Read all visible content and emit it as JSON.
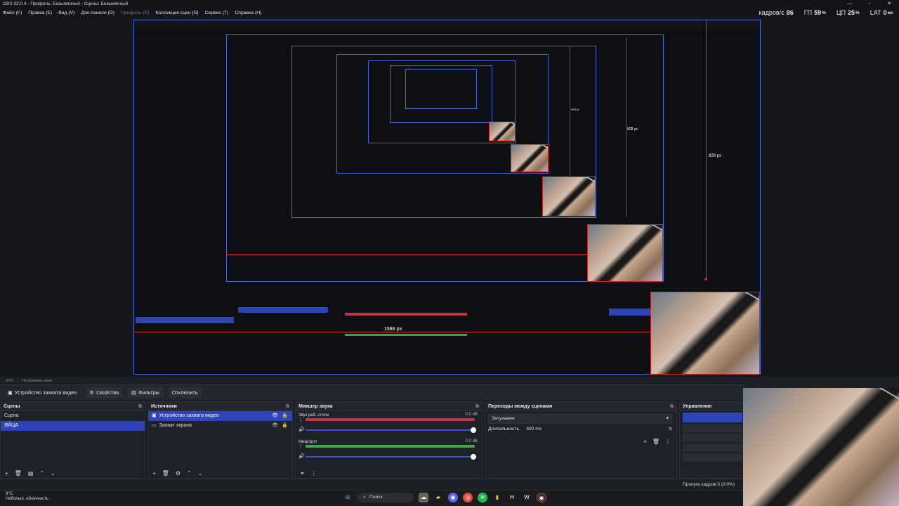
{
  "window": {
    "title": "OBS 32.0.4 - Профиль: Безымянный - Сцены: Безымянный",
    "controls": [
      "—",
      "▫",
      "✕"
    ]
  },
  "menu": [
    {
      "label": "Файл (F)",
      "dim": false
    },
    {
      "label": "Правка (E)",
      "dim": false
    },
    {
      "label": "Вид (V)",
      "dim": false
    },
    {
      "label": "Док-панели (D)",
      "dim": false
    },
    {
      "label": "Профиль (P)",
      "dim": true
    },
    {
      "label": "Коллекция сцен (S)",
      "dim": false
    },
    {
      "label": "Сервис (T)",
      "dim": false
    },
    {
      "label": "Справка (H)",
      "dim": false
    }
  ],
  "stats": {
    "fps_label": "кадров/с",
    "fps": "86",
    "gpu_label": "ГП",
    "gpu": "59",
    "cpu_label": "ЦП",
    "cpu": "25",
    "lat_label": "LAT",
    "lat": "0",
    "lat_unit": "мс",
    "pct": "%"
  },
  "preview": {
    "measure_large": "828 px",
    "measure_mid": "828 px",
    "measure_small": "828 px",
    "width_label": "1586 px"
  },
  "zoom": {
    "value": "92%",
    "mode": "По размеру окна"
  },
  "source_toolbar": {
    "source": "Устройство захвата видео",
    "properties": "Свойства",
    "filters": "Фильтры",
    "deactivate": "Отключить"
  },
  "scenes": {
    "title": "Сцены",
    "items": [
      "Сцена",
      "ЯЙЦА"
    ],
    "selected": 1
  },
  "sources": {
    "title": "Источники",
    "items": [
      "Устройство захвата видео",
      "Захват экрана"
    ],
    "selected": 0
  },
  "mixer": {
    "title": "Микшер звука",
    "tracks": [
      {
        "name": "Звук раб. стола",
        "db": "0.0 dB"
      },
      {
        "name": "Микр/доп",
        "db": "0.0 dB"
      }
    ]
  },
  "transitions": {
    "title": "Переходы между сценами",
    "type": "Затухание",
    "duration_label": "Длительность",
    "duration": "300 ms"
  },
  "controls": {
    "title": "Управление"
  },
  "status": {
    "dropped": "Пропуск кадров 0 (0.0%)"
  },
  "taskbar": {
    "weather_temp": "9°C",
    "weather_desc": "Небольш. облачность",
    "search": "Поиск"
  },
  "icons": {
    "close": "✕",
    "dock_menu": "⧉",
    "eye": "👁",
    "lock": "🔒",
    "speaker": "🔊",
    "menu_dots": "⋮"
  }
}
